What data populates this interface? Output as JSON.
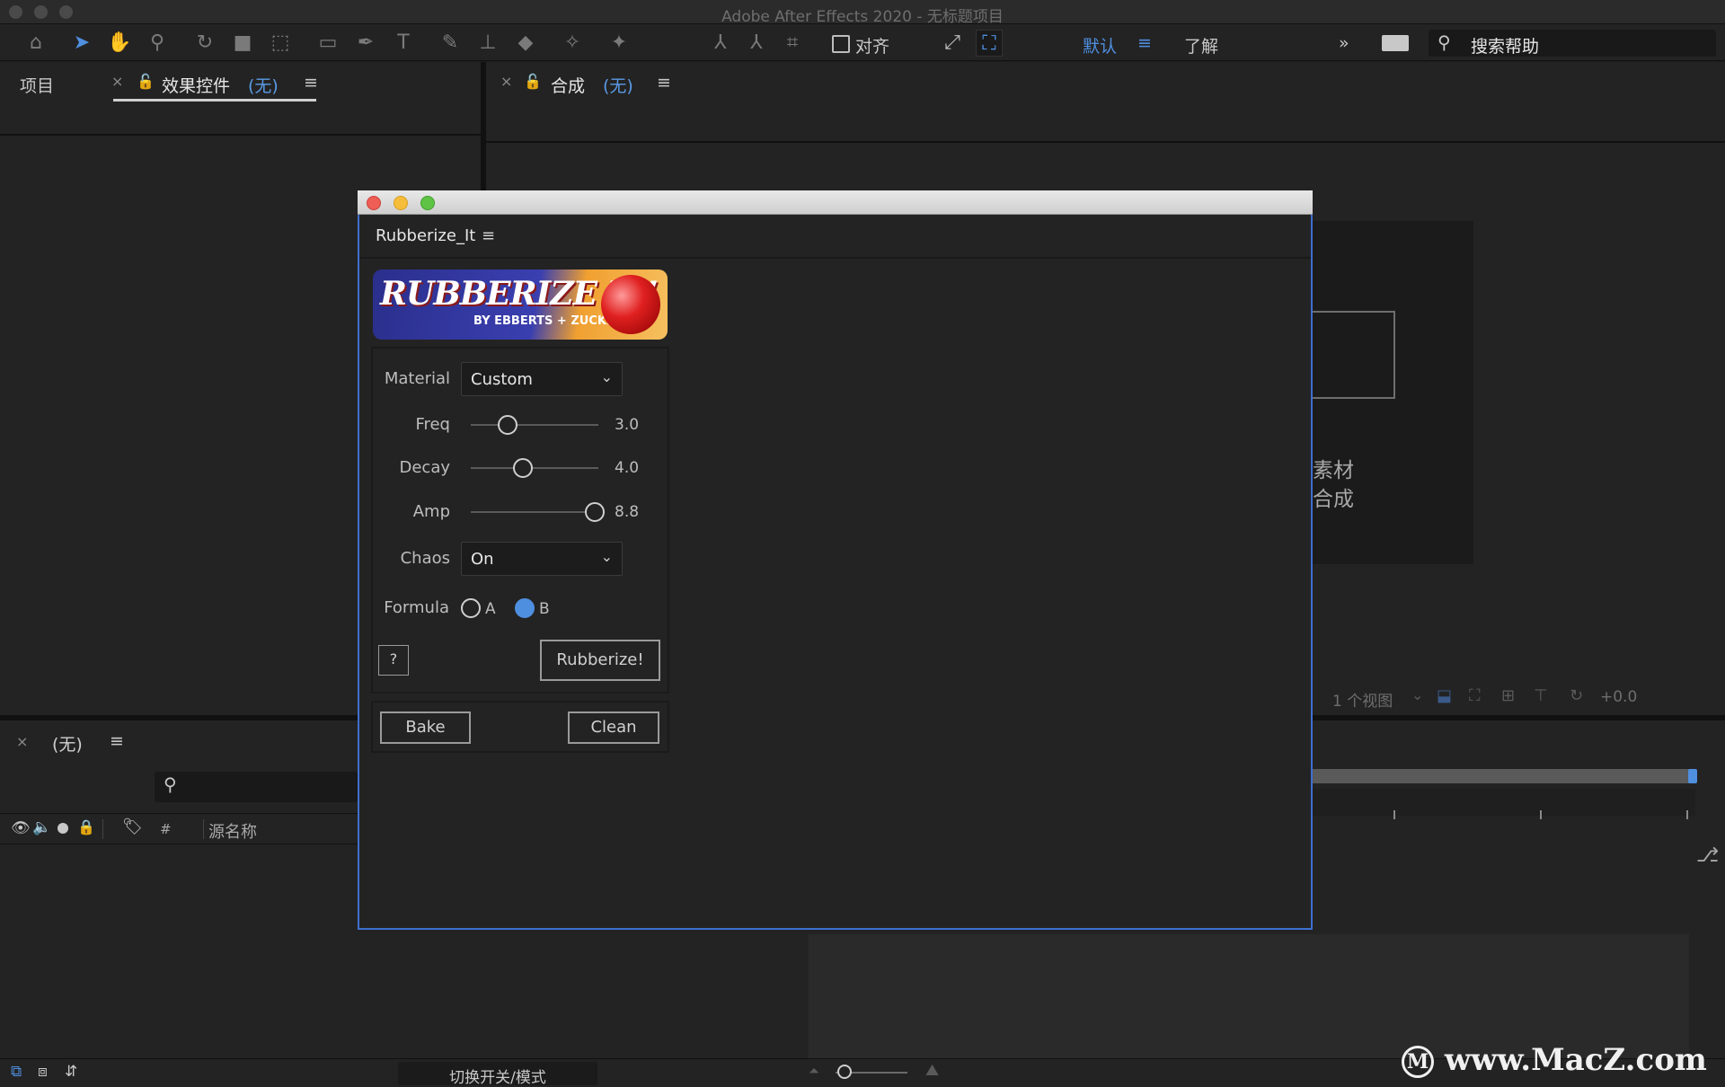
{
  "window": {
    "title": "Adobe After Effects 2020 - 无标题项目"
  },
  "toolbar": {
    "align_label": "对齐",
    "workspace_default": "默认",
    "workspace_learn": "了解",
    "search_help": "搜索帮助"
  },
  "left_panel": {
    "tab_project": "项目",
    "tab_effect_controls": "效果控件",
    "tab_effect_controls_target": "(无)"
  },
  "comp_panel": {
    "tab_label": "合成",
    "tab_target": "(无)",
    "placeholder_line1": "素材",
    "placeholder_line2": "合成",
    "views_label": "1 个视图",
    "exposure_value": "+0.0"
  },
  "timeline": {
    "tab_target": "(无)",
    "col_hash": "#",
    "col_source_name": "源名称",
    "toggle_modes": "切换开关/模式"
  },
  "plugin": {
    "title": "Rubberize_It",
    "logo_text": "RUBBERIZE IT!",
    "logo_subtext": "BY EBBERTS + ZUCKER",
    "material_label": "Material",
    "material_value": "Custom",
    "freq_label": "Freq",
    "freq_value": "3.0",
    "decay_label": "Decay",
    "decay_value": "4.0",
    "amp_label": "Amp",
    "amp_value": "8.8",
    "chaos_label": "Chaos",
    "chaos_value": "On",
    "formula_label": "Formula",
    "formula_option_a": "A",
    "formula_option_b": "B",
    "formula_selected": "B",
    "help_button": "?",
    "rubberize_button": "Rubberize!",
    "bake_button": "Bake",
    "clean_button": "Clean"
  },
  "watermark": "www.MacZ.com"
}
